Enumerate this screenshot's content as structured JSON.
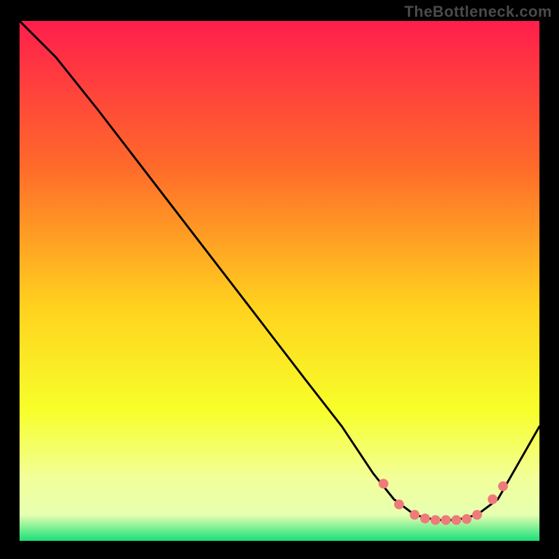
{
  "watermark": "TheBottleneck.com",
  "gradient_colors": {
    "top": "#ff1e4c",
    "mid1": "#ff7a2a",
    "mid2": "#ffd21e",
    "mid3": "#f7ff2a",
    "low": "#e6ffb0",
    "green": "#19e07a"
  },
  "chart_data": {
    "type": "line",
    "title": "",
    "xlabel": "",
    "ylabel": "",
    "xlim": [
      0,
      100
    ],
    "ylim": [
      0,
      100
    ],
    "series": [
      {
        "name": "bottleneck-curve",
        "x": [
          0,
          7,
          15,
          25,
          35,
          45,
          55,
          62,
          68,
          72,
          76,
          80,
          84,
          88,
          92,
          100
        ],
        "y": [
          100,
          93,
          83,
          70,
          57,
          44,
          31,
          22,
          13,
          8,
          5,
          4,
          4,
          5,
          8,
          22
        ]
      }
    ],
    "markers": {
      "name": "highlight-dots",
      "color": "#ef7a7a",
      "x": [
        70,
        73,
        76,
        78,
        80,
        82,
        84,
        86,
        88,
        91,
        93
      ],
      "y": [
        11,
        7,
        5,
        4.3,
        4,
        4,
        4,
        4.2,
        5,
        8,
        10.5
      ]
    }
  }
}
